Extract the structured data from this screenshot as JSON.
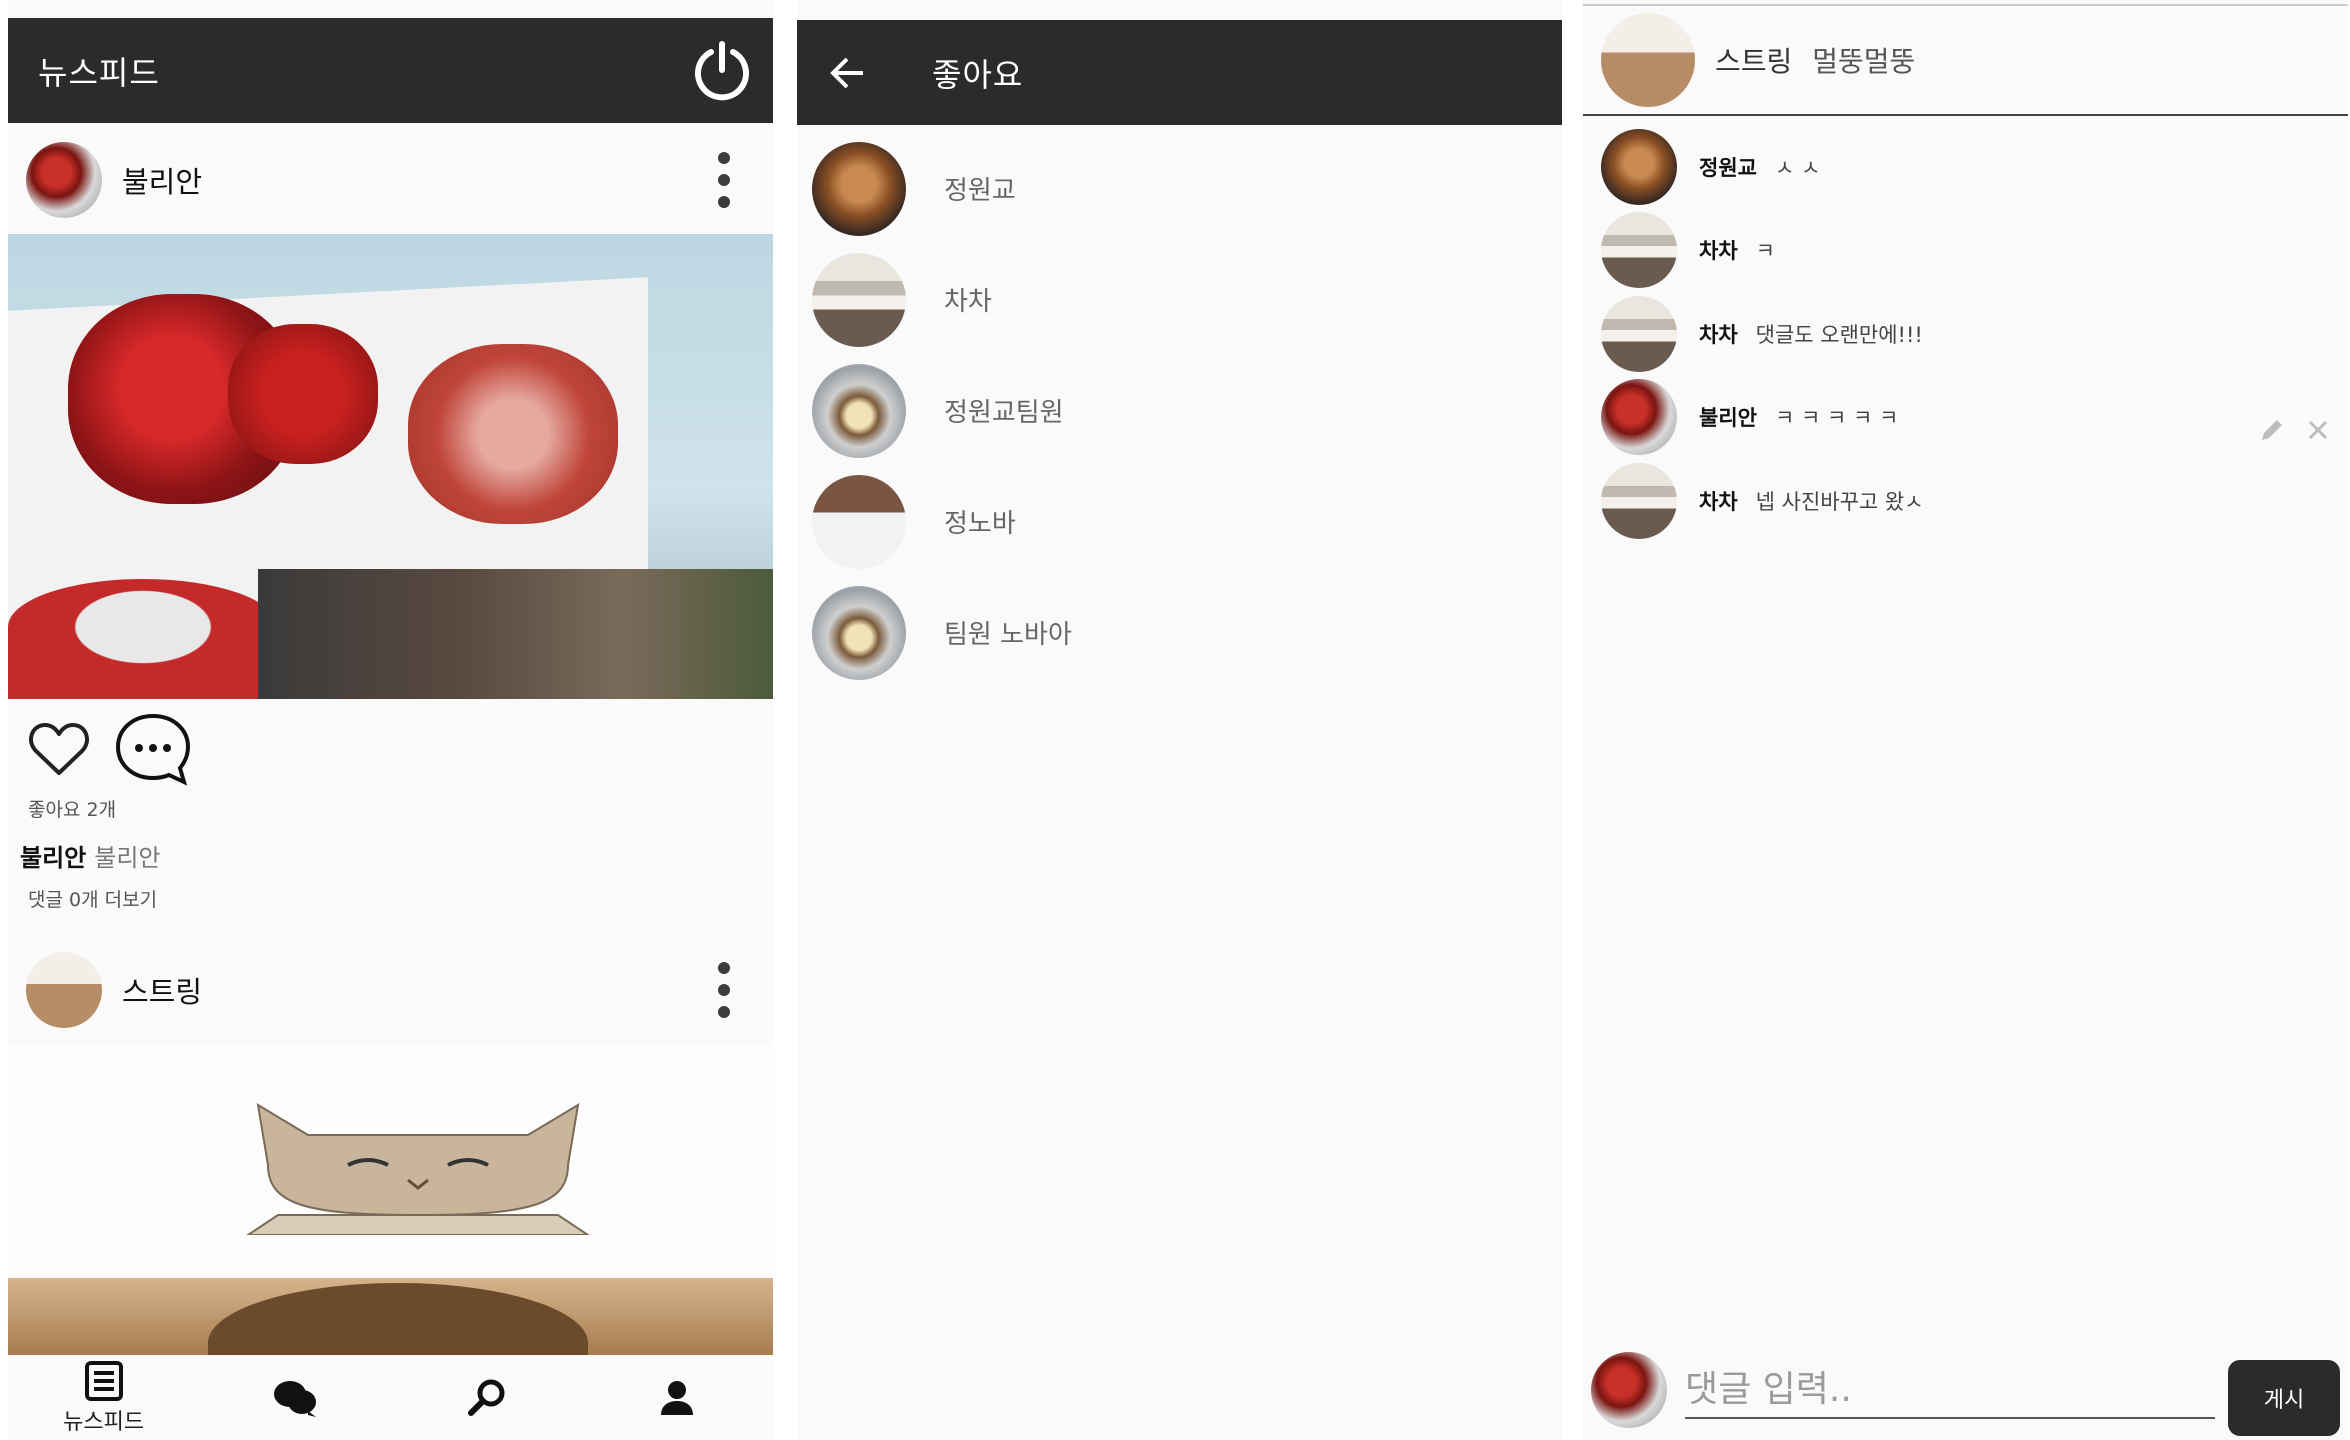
{
  "feed": {
    "title": "뉴스피드",
    "post1": {
      "author": "불리안",
      "likes_text": "좋아요 2개",
      "caption_author": "불리안",
      "caption_text": "불리안",
      "comments_link": "댓글 0개 더보기"
    },
    "post2": {
      "author": "스트링"
    },
    "bottom_nav": {
      "feed_label": "뉴스피드"
    }
  },
  "likes_screen": {
    "title": "좋아요",
    "users": [
      {
        "name": "정원교"
      },
      {
        "name": "차차"
      },
      {
        "name": "정원교팀원"
      },
      {
        "name": "정노바"
      },
      {
        "name": "팀원 노바아"
      }
    ]
  },
  "comments_screen": {
    "post_owner": "스트링",
    "post_caption": "멀뚱멀뚱",
    "comments": [
      {
        "author": "정원교",
        "text": "ㅅ ㅅ"
      },
      {
        "author": "차차",
        "text": "ㅋ"
      },
      {
        "author": "차차",
        "text": "댓글도 오랜만에!!!"
      },
      {
        "author": "불리안",
        "text": "ㅋ ㅋ ㅋ ㅋ ㅋ"
      },
      {
        "author": "차차",
        "text": "넵 사진바꾸고 왔ㅅ"
      }
    ],
    "input_placeholder": "댓글 입력..",
    "post_button": "게시"
  }
}
